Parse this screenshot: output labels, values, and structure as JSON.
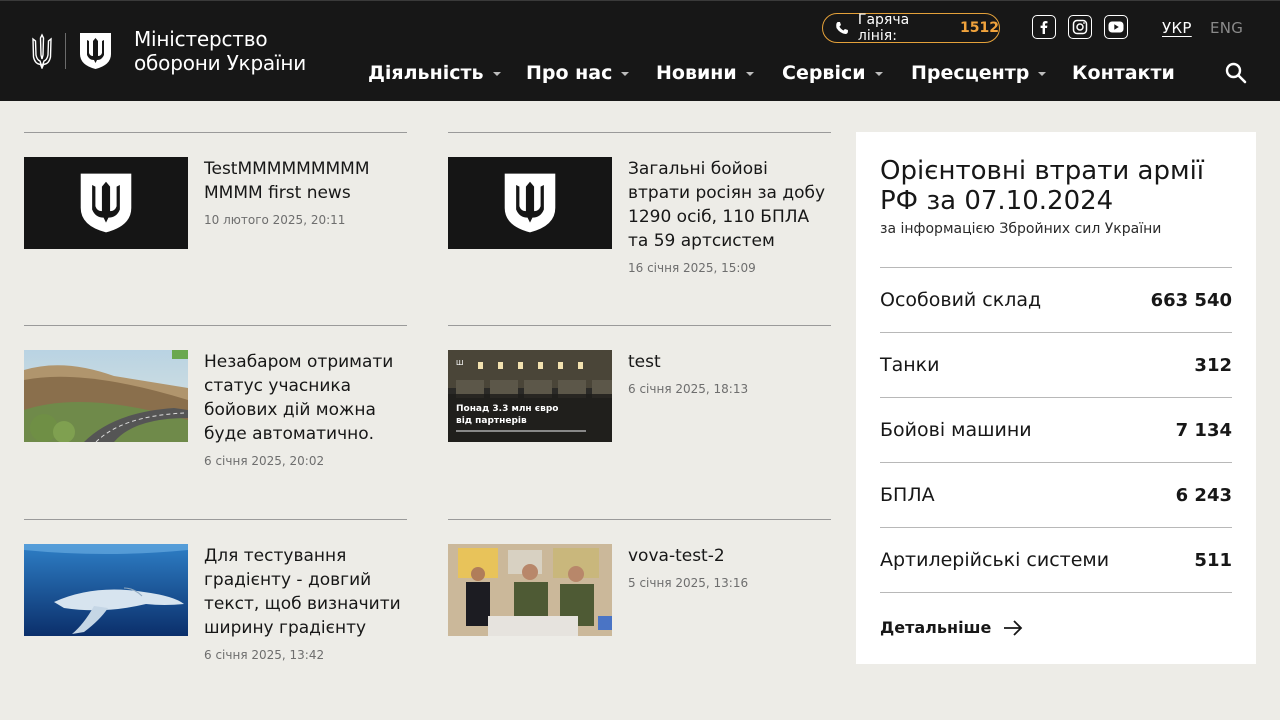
{
  "header": {
    "logo_line1": "Міністерство",
    "logo_line2": "оборони України",
    "hotline_label": "Гаряча лінія:",
    "hotline_number": "1512",
    "social": [
      "facebook-icon",
      "instagram-icon",
      "youtube-icon"
    ],
    "lang_active": "УКР",
    "lang_inactive": "ENG",
    "nav": [
      {
        "label": "Діяльність",
        "dropdown": true
      },
      {
        "label": "Про нас",
        "dropdown": true
      },
      {
        "label": "Новини",
        "dropdown": true
      },
      {
        "label": "Сервіси",
        "dropdown": true
      },
      {
        "label": "Пресцентр",
        "dropdown": true
      },
      {
        "label": "Контакти",
        "dropdown": false
      }
    ],
    "colors": {
      "bg": "#171717",
      "accent": "#f1a33c"
    }
  },
  "news": [
    {
      "title": "TestMMMMMMMMM MMMM first news",
      "date": "10 лютого 2025, 20:11",
      "thumb": "ministry-logo"
    },
    {
      "title": "Загальні бойові втрати росіян за добу 1290 осіб, 110 БПЛА та 59 артсистем",
      "date": "16 січня 2025, 15:09",
      "thumb": "ministry-logo"
    },
    {
      "title": "Незабаром отримати статус учасника бойових дій можна буде автоматично.",
      "date": "6 січня 2025, 20:02",
      "thumb": "mountain-road-photo"
    },
    {
      "title": "test",
      "date": "6 січня 2025, 18:13",
      "thumb": "warehouse-photo",
      "thumb_caption": "Понад 3.3 млн євро від партнерів"
    },
    {
      "title": "Для тестування градієнту - довгий текст, щоб визначити ширину градієнту",
      "date": "6 січня 2025, 13:42",
      "thumb": "whale-photo"
    },
    {
      "title": "vova-test-2",
      "date": "5 січня 2025, 13:16",
      "thumb": "people-photo"
    }
  ],
  "losses": {
    "title": "Орієнтовні втрати армії РФ за 07.10.2024",
    "subtitle": "за інформацією Збройних сил України",
    "rows": [
      {
        "label": "Особовий склад",
        "value": "663 540"
      },
      {
        "label": "Танки",
        "value": "312"
      },
      {
        "label": "Бойові машини",
        "value": "7 134"
      },
      {
        "label": "БПЛА",
        "value": "6 243"
      },
      {
        "label": "Артилерійські системи",
        "value": "511"
      }
    ],
    "more_label": "Детальніше"
  }
}
